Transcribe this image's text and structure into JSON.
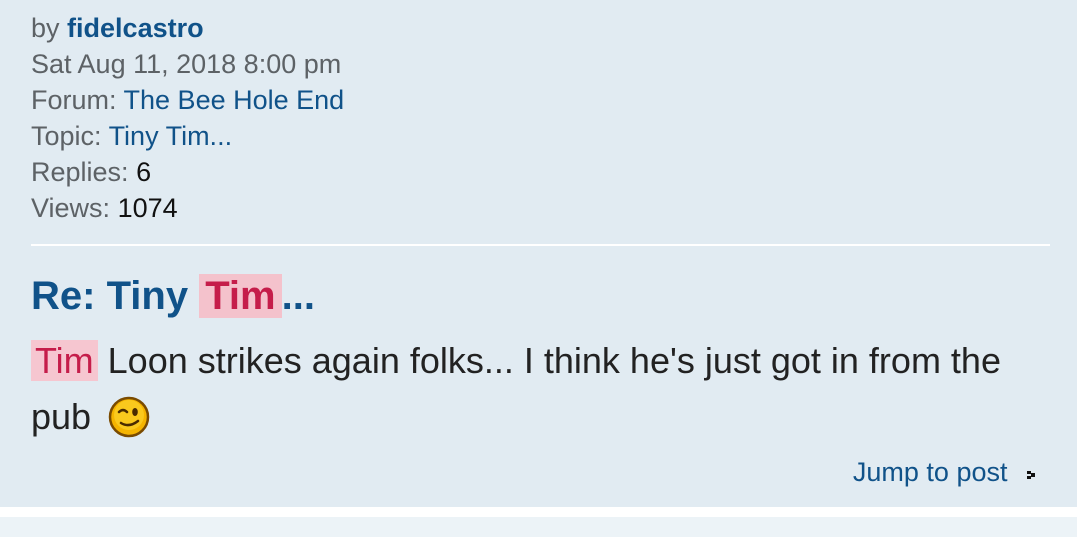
{
  "post": {
    "by_label": "by",
    "author": "fidelcastro",
    "date": "Sat Aug 11, 2018 8:00 pm",
    "forum_label": "Forum:",
    "forum_name": "The Bee Hole End",
    "topic_label": "Topic:",
    "topic_name": "Tiny Tim...",
    "replies_label": "Replies:",
    "replies_value": "6",
    "views_label": "Views:",
    "views_value": "1074",
    "title_prefix": "Re: Tiny",
    "title_highlight": "Tim",
    "title_suffix": "...",
    "content_highlight": "Tim",
    "content_text": "Loon strikes again folks... I think he's just got in from the pub",
    "smiley_icon": "wink-smiley-icon",
    "jump_label": "Jump to post",
    "jump_icon": "arrow-right-icon"
  },
  "colors": {
    "post_background": "#e1ebf2",
    "link": "#105289",
    "highlight_background": "#f4c2cc",
    "highlight_text": "#c51d4a"
  }
}
